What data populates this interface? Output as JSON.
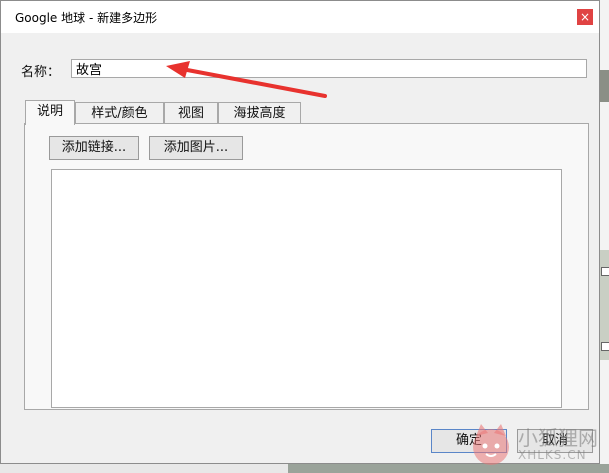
{
  "window": {
    "title": "Google 地球 - 新建多边形",
    "close_glyph": "×"
  },
  "form": {
    "name_label": "名称：",
    "name_value": "故宫"
  },
  "tabs": [
    {
      "label": "说明",
      "active": true
    },
    {
      "label": "样式/颜色",
      "active": false
    },
    {
      "label": "视图",
      "active": false
    },
    {
      "label": "海拔高度",
      "active": false
    }
  ],
  "description_panel": {
    "add_link_label": "添加链接...",
    "add_image_label": "添加图片...",
    "text": ""
  },
  "footer": {
    "ok_label": "确定",
    "cancel_label": "取消"
  },
  "watermark": {
    "title": "小狐狸网",
    "subtitle": "XHLKS.CN"
  },
  "colors": {
    "annotation_arrow": "#e8322e",
    "ok_border": "#5a86c8"
  }
}
